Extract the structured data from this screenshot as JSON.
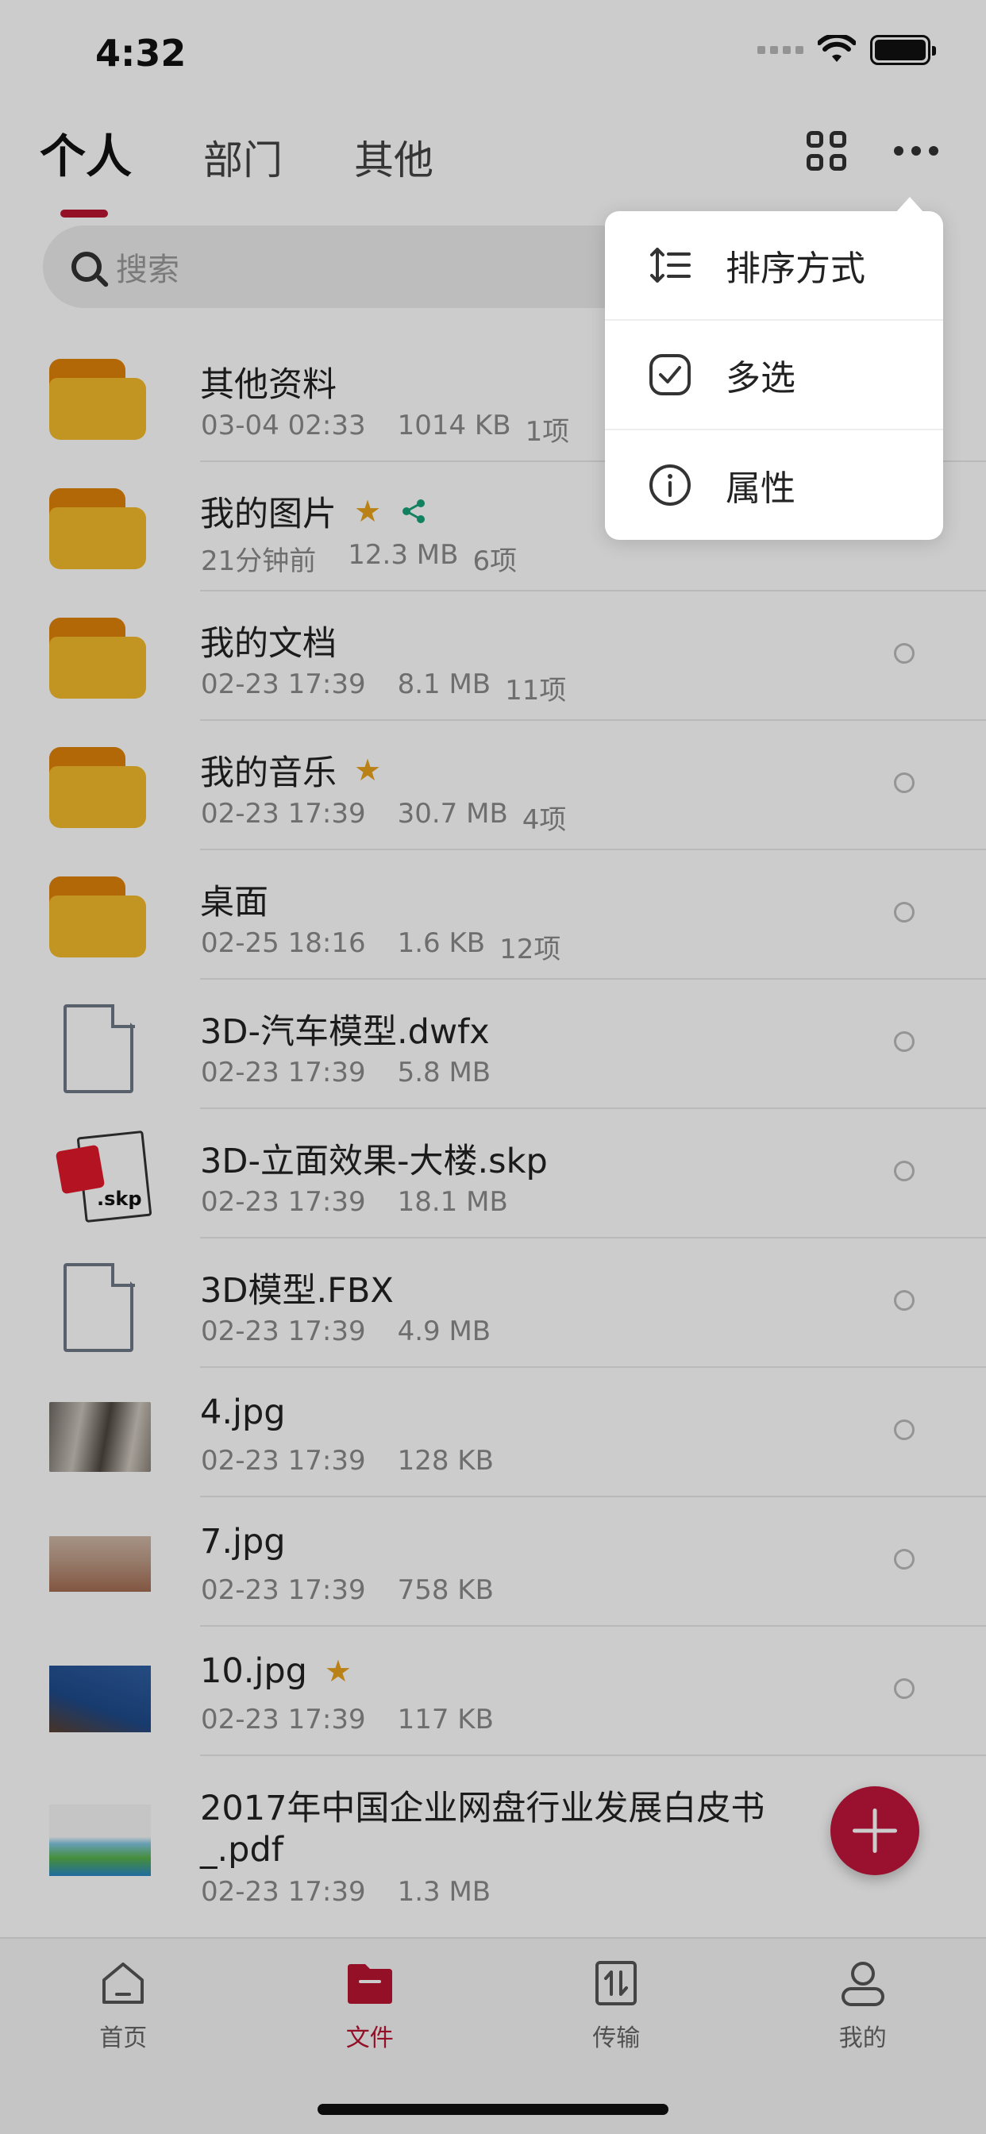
{
  "status_bar": {
    "time": "4:32"
  },
  "header": {
    "tabs": [
      {
        "label": "个人",
        "active": true
      },
      {
        "label": "部门",
        "active": false
      },
      {
        "label": "其他",
        "active": false
      }
    ],
    "icons": [
      "grid-view-icon",
      "more-icon"
    ]
  },
  "search": {
    "placeholder": "搜索"
  },
  "files": [
    {
      "name": "其他资料",
      "date": "03-04 02:33",
      "size": "1014 KB",
      "count": "1项",
      "type": "folder",
      "starred": false,
      "shared": false
    },
    {
      "name": "我的图片",
      "date": "21分钟前",
      "size": "12.3 MB",
      "count": "6项",
      "type": "folder",
      "starred": true,
      "shared": true
    },
    {
      "name": "我的文档",
      "date": "02-23 17:39",
      "size": "8.1 MB",
      "count": "11项",
      "type": "folder",
      "starred": false,
      "shared": false
    },
    {
      "name": "我的音乐",
      "date": "02-23 17:39",
      "size": "30.7 MB",
      "count": "4项",
      "type": "folder",
      "starred": true,
      "shared": false
    },
    {
      "name": "桌面",
      "date": "02-25 18:16",
      "size": "1.6 KB",
      "count": "12项",
      "type": "folder",
      "starred": false,
      "shared": false
    },
    {
      "name": "3D-汽车模型.dwfx",
      "date": "02-23 17:39",
      "size": "5.8 MB",
      "count": "",
      "type": "doc",
      "starred": false,
      "shared": false
    },
    {
      "name": "3D-立面效果-大楼.skp",
      "date": "02-23 17:39",
      "size": "18.1 MB",
      "count": "",
      "type": "skp",
      "skp_label": ".skp",
      "starred": false,
      "shared": false
    },
    {
      "name": "3D模型.FBX",
      "date": "02-23 17:39",
      "size": "4.9 MB",
      "count": "",
      "type": "doc",
      "starred": false,
      "shared": false
    },
    {
      "name": "4.jpg",
      "date": "02-23 17:39",
      "size": "128 KB",
      "count": "",
      "type": "image",
      "starred": false,
      "shared": false
    },
    {
      "name": "7.jpg",
      "date": "02-23 17:39",
      "size": "758 KB",
      "count": "",
      "type": "image",
      "starred": false,
      "shared": false
    },
    {
      "name": "10.jpg",
      "date": "02-23 17:39",
      "size": "117 KB",
      "count": "",
      "type": "image",
      "starred": true,
      "shared": false
    },
    {
      "name_line1": "2017年中国企业网盘行业发展白皮书",
      "name_line2": "_.pdf",
      "date": "02-23 17:39",
      "size": "1.3 MB",
      "count": "",
      "type": "pdf",
      "starred": false,
      "shared": false
    }
  ],
  "popup_menu": {
    "items": [
      {
        "label": "排序方式",
        "icon": "sort-icon"
      },
      {
        "label": "多选",
        "icon": "checkbox-icon"
      },
      {
        "label": "属性",
        "icon": "info-icon"
      }
    ]
  },
  "fab": {
    "icon": "plus-icon"
  },
  "tabbar": {
    "items": [
      {
        "label": "首页",
        "icon": "home-icon",
        "active": false
      },
      {
        "label": "文件",
        "icon": "folder-icon",
        "active": true
      },
      {
        "label": "传输",
        "icon": "transfer-icon",
        "active": false
      },
      {
        "label": "我的",
        "icon": "user-icon",
        "active": false
      }
    ]
  },
  "colors": {
    "accent": "#b81431",
    "folder_tab": "#e0820b",
    "folder_body": "#f3b92b",
    "star": "#e9a21c",
    "share": "#17a279"
  }
}
